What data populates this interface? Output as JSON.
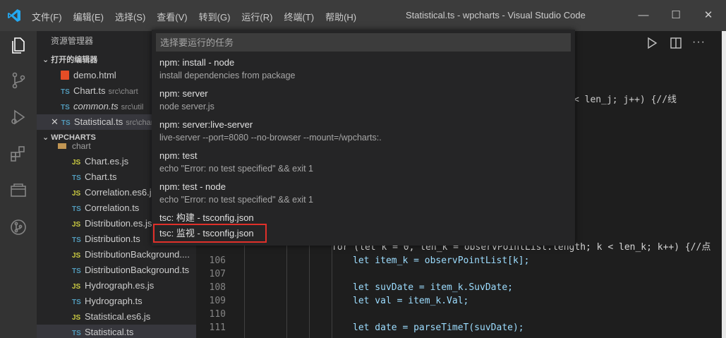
{
  "window": {
    "title": "Statistical.ts - wpcharts - Visual Studio Code",
    "minimize": "—",
    "maximize": "☐",
    "close": "✕"
  },
  "menu": [
    "文件(F)",
    "编辑(E)",
    "选择(S)",
    "查看(V)",
    "转到(G)",
    "运行(R)",
    "终端(T)",
    "帮助(H)"
  ],
  "sidebar": {
    "header": "资源管理器",
    "open_editors_title": "打开的编辑器",
    "open_editors": [
      {
        "name": "demo.html",
        "type": "html",
        "desc": ""
      },
      {
        "name": "Chart.ts",
        "type": "ts",
        "desc": "src\\chart"
      },
      {
        "name": "common.ts",
        "type": "ts",
        "desc": "src\\util"
      },
      {
        "name": "Statistical.ts",
        "type": "ts",
        "desc": "src\\chart"
      }
    ],
    "workspace_title": "WPCHARTS",
    "folder": "chart",
    "files": [
      {
        "name": "Chart.es.js",
        "type": "js"
      },
      {
        "name": "Chart.ts",
        "type": "ts"
      },
      {
        "name": "Correlation.es6.js",
        "type": "js"
      },
      {
        "name": "Correlation.ts",
        "type": "ts"
      },
      {
        "name": "Distribution.es.js",
        "type": "js"
      },
      {
        "name": "Distribution.ts",
        "type": "ts"
      },
      {
        "name": "DistributionBackground....",
        "type": "js"
      },
      {
        "name": "DistributionBackground.ts",
        "type": "ts"
      },
      {
        "name": "Hydrograph.es.js",
        "type": "js"
      },
      {
        "name": "Hydrograph.ts",
        "type": "ts"
      },
      {
        "name": "Statistical.es6.js",
        "type": "js"
      },
      {
        "name": "Statistical.ts",
        "type": "ts"
      }
    ],
    "ts_badge": "TS",
    "js_badge": "JS",
    "close_mark": "✕"
  },
  "quick_pick": {
    "placeholder": "选择要运行的任务",
    "items": [
      {
        "label": "npm: install - node",
        "detail": "install dependencies from package"
      },
      {
        "label": "npm: server",
        "detail": "node server.js"
      },
      {
        "label": "npm: server:live-server",
        "detail": "live-server --port=8080 --no-browser --mount=/wpcharts:."
      },
      {
        "label": "npm: test",
        "detail": "echo \"Error: no test specified\" && exit 1"
      },
      {
        "label": "npm: test - node",
        "detail": "echo \"Error: no test specified\" && exit 1"
      },
      {
        "label": "tsc: 构建 - tsconfig.json",
        "detail": ""
      },
      {
        "label": "tsc: 监视 - tsconfig.json",
        "detail": ""
      }
    ]
  },
  "code": {
    "partial_top": "< len_j; j++) {//线",
    "partial_for": "for (let k = 0, len_k = observPointList.length; k < len_k; k++) {//点",
    "lines": [
      {
        "num": "106",
        "text": "let item_k = observPointList[k];"
      },
      {
        "num": "107",
        "text": ""
      },
      {
        "num": "108",
        "text": "let suvDate = item_k.SuvDate;"
      },
      {
        "num": "109",
        "text": "let val = item_k.Val;"
      },
      {
        "num": "110",
        "text": ""
      },
      {
        "num": "111",
        "text": "let date = parseTimeT(suvDate);"
      }
    ]
  },
  "colors": {
    "highlight_box": "#e0302a",
    "accent": "#007acc"
  }
}
